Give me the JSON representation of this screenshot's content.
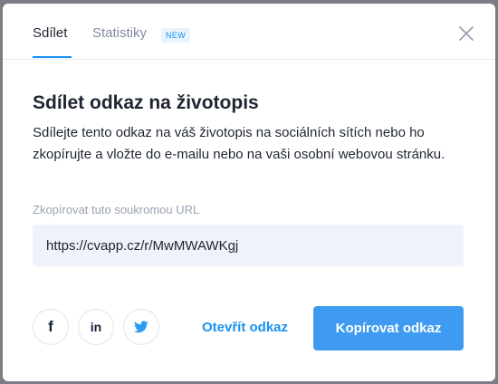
{
  "tabs": {
    "share_label": "Sdílet",
    "stats_label": "Statistiky",
    "new_badge": "NEW"
  },
  "content": {
    "title": "Sdílet odkaz na životopis",
    "description": "Sdílejte tento odkaz na váš životopis na sociálních sítích nebo ho zkopírujte a vložte do e-mailu nebo na vaši osobní webovou stránku.",
    "url_label": "Zkopírovat tuto soukromou URL",
    "url_value": "https://cvapp.cz/r/MwMWAWKgj"
  },
  "social": {
    "facebook_glyph": "f",
    "linkedin_glyph": "in",
    "icons": [
      "facebook-icon",
      "linkedin-icon",
      "twitter-icon"
    ]
  },
  "actions": {
    "open_label": "Otevřít odkaz",
    "copy_label": "Kopírovat odkaz"
  },
  "colors": {
    "accent": "#1a91f0",
    "primary_button": "#3f9bf1",
    "text": "#1e2532",
    "muted": "#828ba2",
    "field_bg": "#eff2f9"
  }
}
